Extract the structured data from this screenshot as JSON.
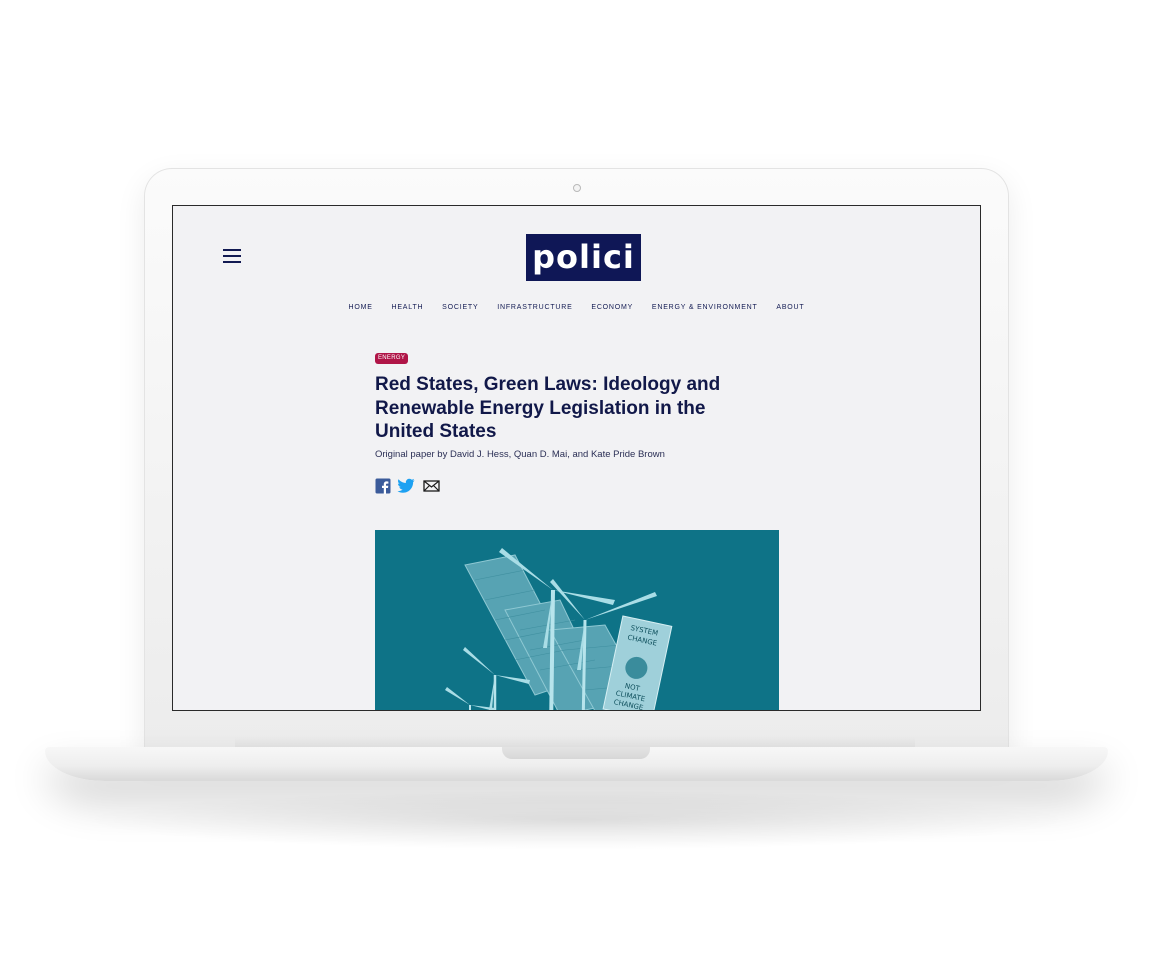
{
  "site": {
    "logo_text": "polici",
    "brand_color": "#0f1756",
    "accent_color": "#b01547"
  },
  "nav": {
    "items": [
      "HOME",
      "HEALTH",
      "SOCIETY",
      "INFRASTRUCTURE",
      "ECONOMY",
      "ENERGY & ENVIRONMENT",
      "ABOUT"
    ]
  },
  "article": {
    "category": "ENERGY",
    "title_lines": [
      "Red States, Green Laws: Ideology and",
      "Renewable Energy Legislation in the",
      "United States"
    ],
    "byline": "Original paper by David J. Hess, Quan D. Mai, and Kate Pride Brown",
    "share_icons": [
      "facebook-icon",
      "twitter-icon",
      "email-icon"
    ],
    "hero_image": {
      "description_icon": "wind-turbines-solar-panels-image",
      "sign_text": [
        "SYSTEM",
        "CHANGE",
        "NOT",
        "CLIMATE",
        "CHANGE"
      ]
    }
  }
}
